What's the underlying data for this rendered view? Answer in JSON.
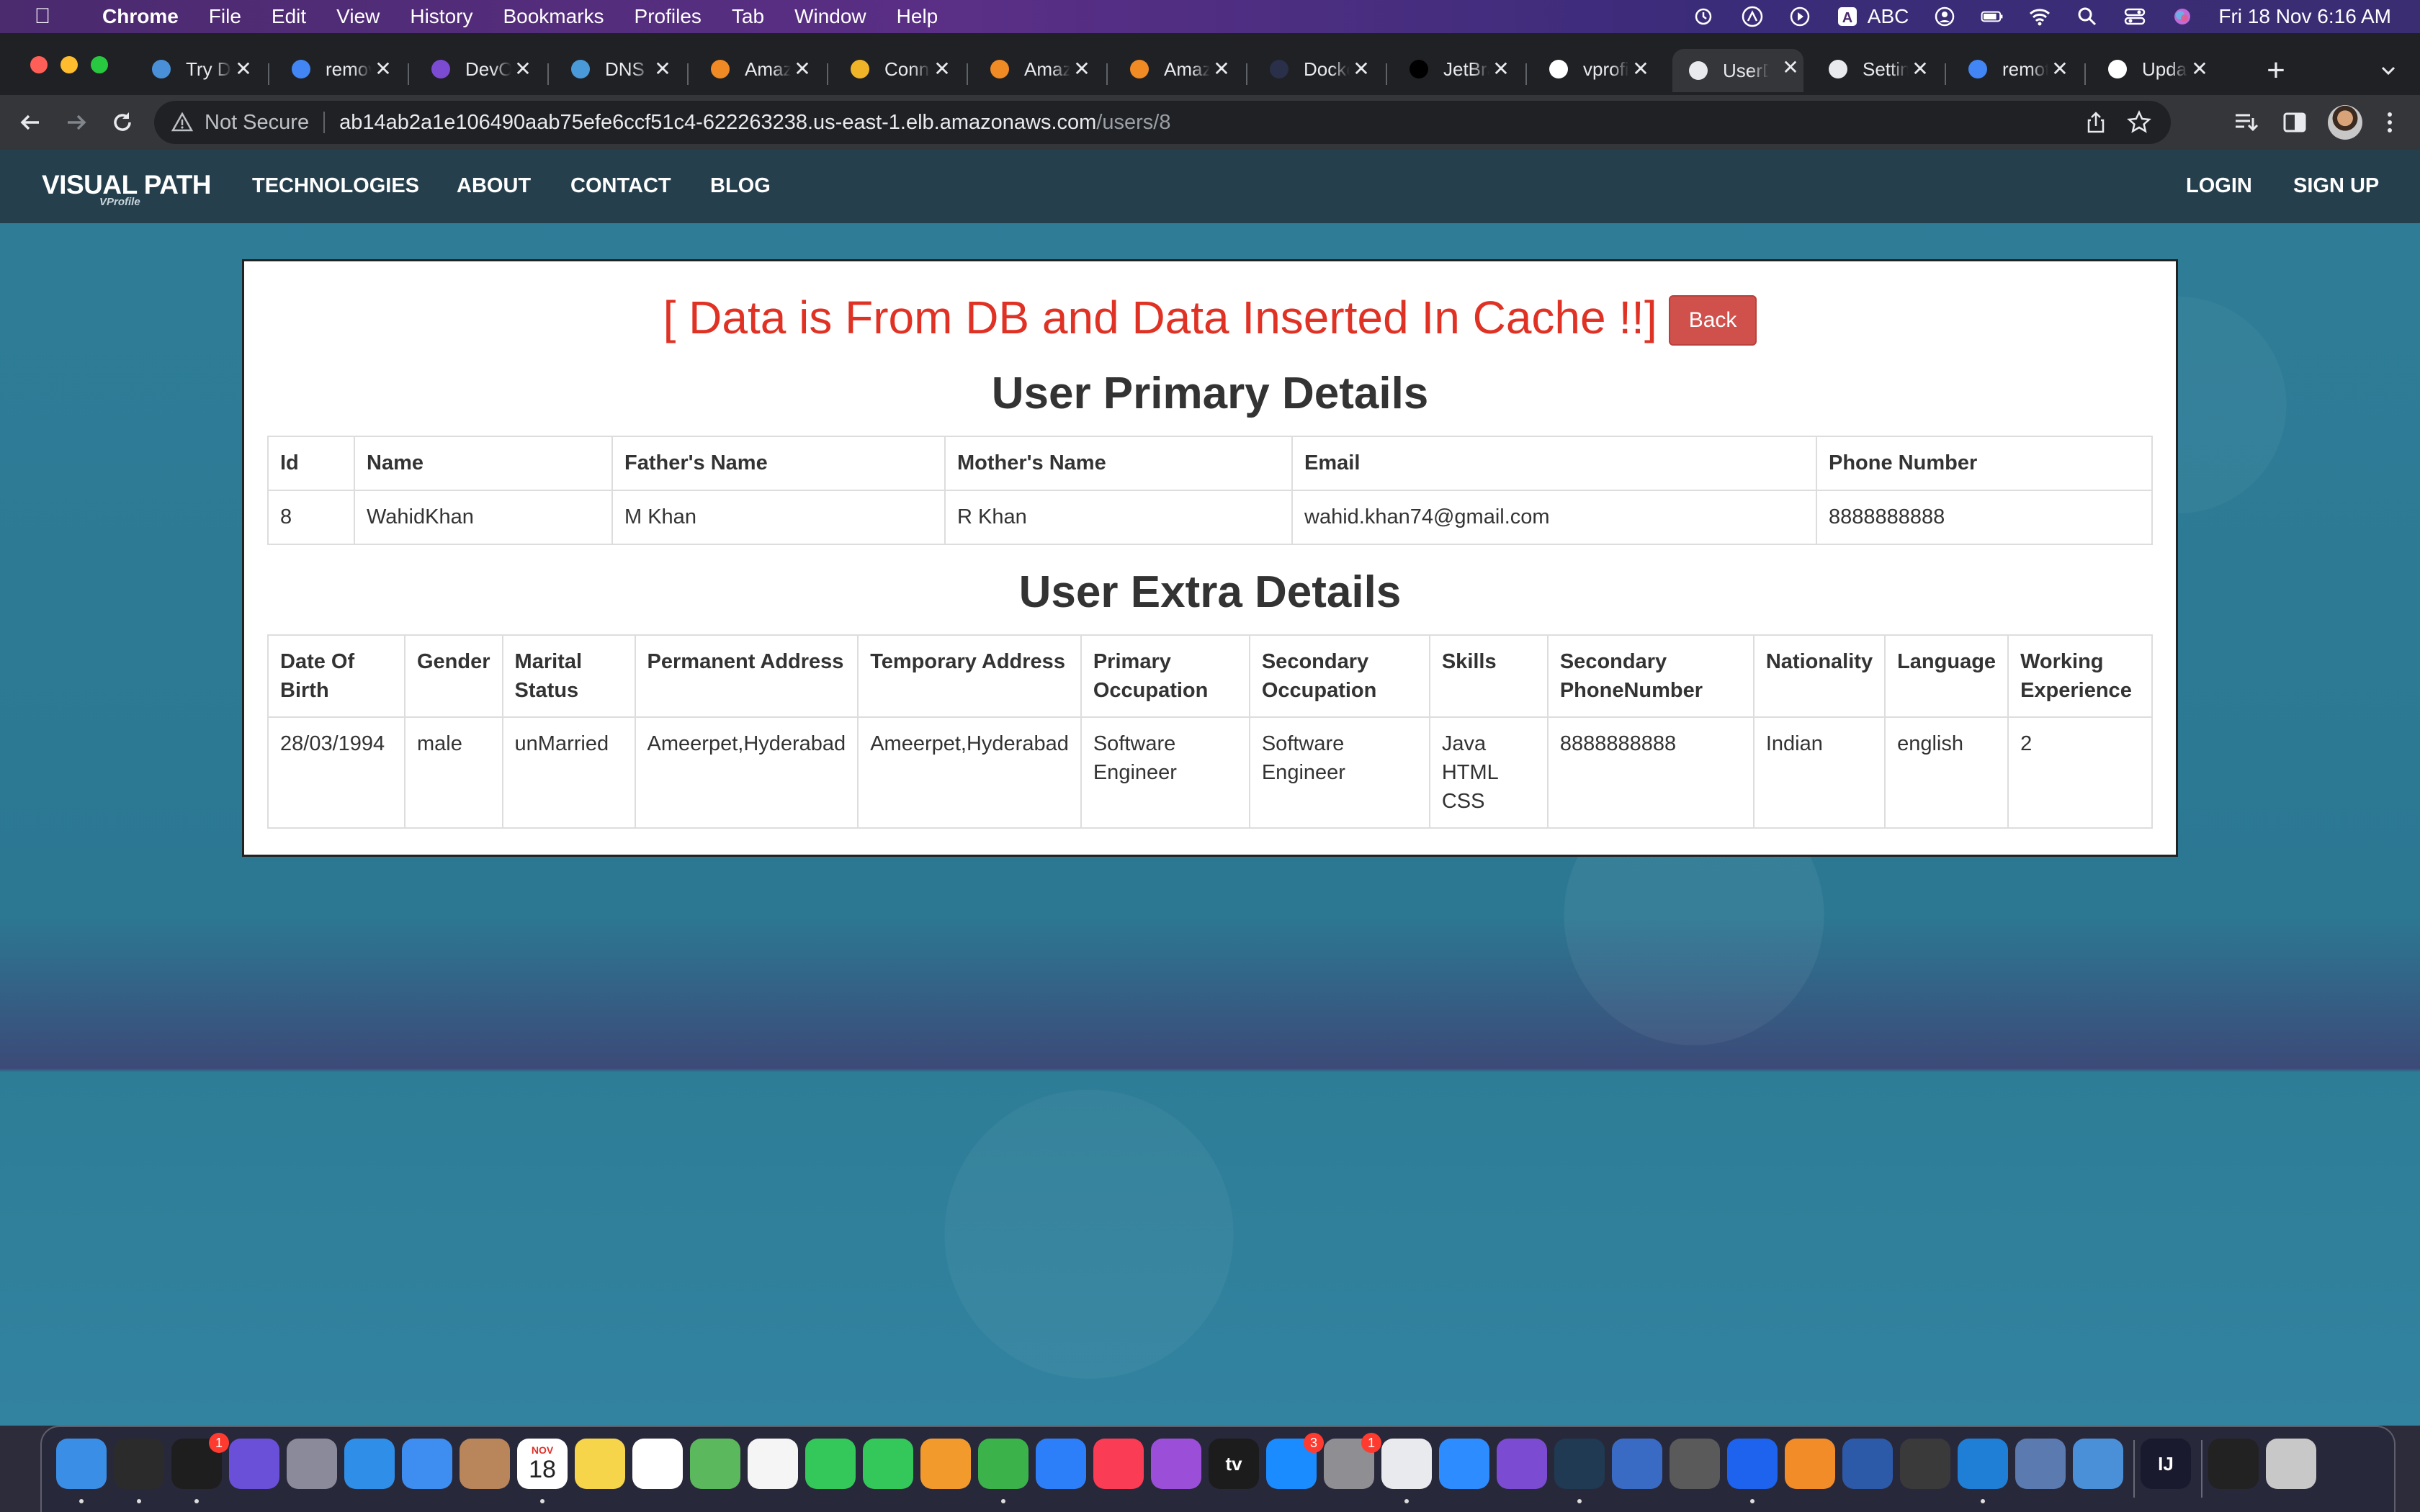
{
  "menubar": {
    "app_name": "Chrome",
    "menus": [
      "File",
      "Edit",
      "View",
      "History",
      "Bookmarks",
      "Profiles",
      "Tab",
      "Window",
      "Help"
    ],
    "input_source": "ABC",
    "datetime": "Fri 18 Nov  6:16 AM"
  },
  "browser": {
    "tabs": [
      {
        "label": "Try Docker",
        "icon": "docker-swirl-icon",
        "color": "#4a90d9"
      },
      {
        "label": "remove",
        "icon": "google-icon",
        "color": "#4285f4"
      },
      {
        "label": "DevOps",
        "icon": "devops-icon",
        "color": "#7b4bd1"
      },
      {
        "label": "DNS M",
        "icon": "dns-icon",
        "color": "#4a9ad9"
      },
      {
        "label": "Amazon",
        "icon": "aws-box-icon",
        "color": "#f08a24"
      },
      {
        "label": "Connect",
        "icon": "aws-box-icon",
        "color": "#f0b429"
      },
      {
        "label": "Amazon",
        "icon": "aws-box-icon",
        "color": "#f08a24"
      },
      {
        "label": "Amazon",
        "icon": "aws-box-icon",
        "color": "#f08a24"
      },
      {
        "label": "Docker",
        "icon": "docker-icon",
        "color": "#2a2f4a"
      },
      {
        "label": "JetBrains",
        "icon": "jetbrains-icon",
        "color": "#000000"
      },
      {
        "label": "vprofile",
        "icon": "github-icon",
        "color": "#ffffff"
      },
      {
        "label": "UserData",
        "icon": "globe-icon",
        "color": "#e8eaed",
        "active": true
      },
      {
        "label": "Settings",
        "icon": "gear-icon",
        "color": "#e8eaed"
      },
      {
        "label": "remote",
        "icon": "google-icon",
        "color": "#4285f4"
      },
      {
        "label": "Update",
        "icon": "github-icon",
        "color": "#ffffff"
      }
    ],
    "security_label": "Not Secure",
    "url_host": "ab14ab2a1e106490aab75efe6ccf51c4-622263238.us-east-1.elb.amazonaws.com",
    "url_path": "/users/8"
  },
  "site": {
    "brand": "VISUAL PATH",
    "brand_sub": "VProfile",
    "nav": [
      "TECHNOLOGIES",
      "ABOUT",
      "CONTACT",
      "BLOG"
    ],
    "nav_right": [
      "LOGIN",
      "SIGN UP"
    ]
  },
  "content": {
    "banner": "[ Data is From DB and Data Inserted In Cache !!]",
    "back_label": "Back",
    "primary_title": "User Primary Details",
    "primary_headers": [
      "Id",
      "Name",
      "Father's Name",
      "Mother's Name",
      "Email",
      "Phone Number"
    ],
    "primary_row": [
      "8",
      "WahidKhan",
      "M Khan",
      "R Khan",
      "wahid.khan74@gmail.com",
      "8888888888"
    ],
    "extra_title": "User Extra Details",
    "extra_headers": [
      "Date Of Birth",
      "Gender",
      "Marital Status",
      "Permanent Address",
      "Temporary Address",
      "Primary Occupation",
      "Secondary Occupation",
      "Skills",
      "Secondary PhoneNumber",
      "Nationality",
      "Language",
      "Working Experience"
    ],
    "extra_row": [
      "28/03/1994",
      "male",
      "unMarried",
      "Ameerpet,Hyderabad",
      "Ameerpet,Hyderabad",
      "Software Engineer",
      "Software Engineer",
      "Java\nHTML\nCSS",
      "8888888888",
      "Indian",
      "english",
      "2"
    ]
  },
  "dock": {
    "apps": [
      {
        "name": "finder-icon",
        "color": "#3a8ee6"
      },
      {
        "name": "activity-monitor-icon",
        "color": "#2b2b2b"
      },
      {
        "name": "terminal-icon",
        "color": "#1e1e1e",
        "badge": "1"
      },
      {
        "name": "siri-icon",
        "color": "#6a4fd8"
      },
      {
        "name": "launchpad-icon",
        "color": "#8a8a9a"
      },
      {
        "name": "safari-icon",
        "color": "#2f8fe8"
      },
      {
        "name": "mail-icon",
        "color": "#3d8ef0"
      },
      {
        "name": "contacts-icon",
        "color": "#b8865a"
      },
      {
        "name": "calendar-icon",
        "color": "#ffffff",
        "text": "18",
        "subtext": "NOV"
      },
      {
        "name": "notes-icon",
        "color": "#f7d54a"
      },
      {
        "name": "reminders-icon",
        "color": "#ffffff"
      },
      {
        "name": "maps-icon",
        "color": "#5cb85c"
      },
      {
        "name": "photos-icon",
        "color": "#f5f5f5"
      },
      {
        "name": "messages-icon",
        "color": "#34c759"
      },
      {
        "name": "facetime-icon",
        "color": "#34c759"
      },
      {
        "name": "pages-icon",
        "color": "#f39a2c"
      },
      {
        "name": "numbers-icon",
        "color": "#3bb34a"
      },
      {
        "name": "keynote-icon",
        "color": "#2d7ff9"
      },
      {
        "name": "music-icon",
        "color": "#fa3c55"
      },
      {
        "name": "podcasts-icon",
        "color": "#9b4fd9"
      },
      {
        "name": "apple-tv-icon",
        "color": "#1c1c1c",
        "text": "tv"
      },
      {
        "name": "app-store-icon",
        "color": "#1a8cff",
        "badge": "3"
      },
      {
        "name": "system-preferences-icon",
        "color": "#8e8e93",
        "badge": "1"
      },
      {
        "name": "chrome-icon",
        "color": "#e8eaed"
      },
      {
        "name": "zoom-icon",
        "color": "#2d8cff"
      },
      {
        "name": "github-desktop-icon",
        "color": "#7b4bd1"
      },
      {
        "name": "mysql-workbench-icon",
        "color": "#1f3a52"
      },
      {
        "name": "multipass-icon",
        "color": "#3a6bc4"
      },
      {
        "name": "gimp-icon",
        "color": "#5a5a5a"
      },
      {
        "name": "docker-desktop-icon",
        "color": "#1d63ed"
      },
      {
        "name": "sublime-icon",
        "color": "#f28c28"
      },
      {
        "name": "virtualbox-icon",
        "color": "#2d5aa8"
      },
      {
        "name": "loading-app-icon",
        "color": "#3a3a3a"
      },
      {
        "name": "vscode-icon",
        "color": "#1f7fd6"
      },
      {
        "name": "monitor-app-icon",
        "color": "#5a7ab0"
      },
      {
        "name": "xquartz-icon",
        "color": "#4a90d9"
      },
      {
        "name": "intellij-icon",
        "color": "#1a1a2e",
        "text": "IJ"
      },
      {
        "name": "recent-window-icon",
        "color": "#222222"
      },
      {
        "name": "trash-icon",
        "color": "#c8c8c8"
      }
    ]
  }
}
